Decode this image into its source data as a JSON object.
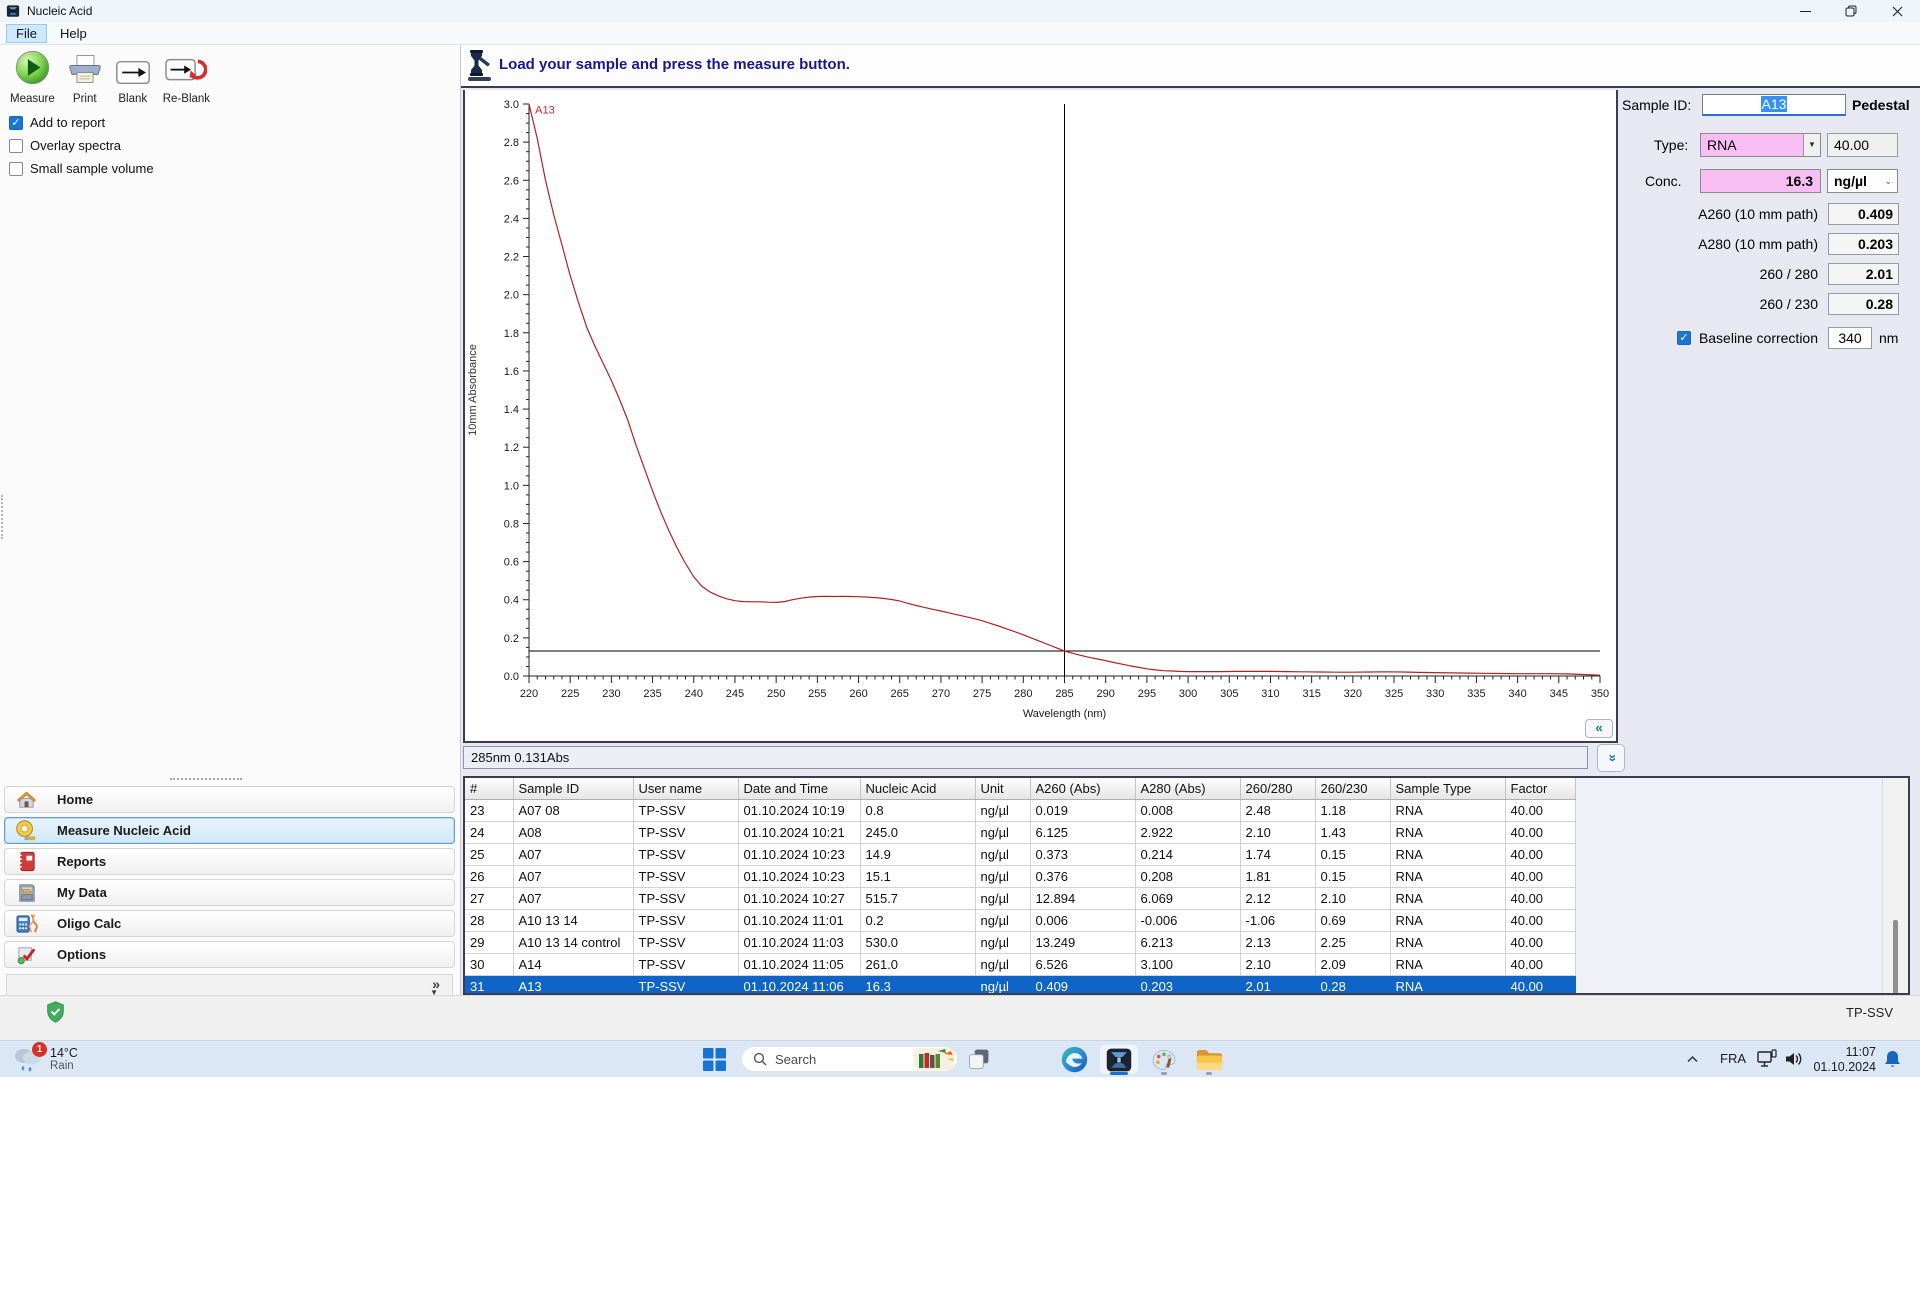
{
  "window": {
    "title": "Nucleic Acid"
  },
  "menu": {
    "items": [
      {
        "label": "File",
        "active": true
      },
      {
        "label": "Help",
        "active": false
      }
    ]
  },
  "toolbar": {
    "buttons": [
      {
        "icon": "measure-icon",
        "label": "Measure"
      },
      {
        "icon": "print-icon",
        "label": "Print"
      },
      {
        "icon": "blank-icon",
        "label": "Blank"
      },
      {
        "icon": "reblank-icon",
        "label": "Re-Blank"
      }
    ]
  },
  "report_options": [
    {
      "label": "Add to report",
      "checked": true
    },
    {
      "label": "Overlay spectra",
      "checked": false
    },
    {
      "label": "Small sample volume",
      "checked": false
    }
  ],
  "status_message": "Load your sample and press the measure button.",
  "readout": "285nm 0.131Abs",
  "sample_panel": {
    "sample_id_label": "Sample ID:",
    "sample_id_value": "A13",
    "mode_label": "Pedestal",
    "type_label": "Type:",
    "type_value": "RNA",
    "type_factor": "40.00",
    "conc_label": "Conc.",
    "conc_value": "16.3",
    "conc_unit": "ng/µl",
    "metrics": [
      {
        "label": "A260 (10 mm path)",
        "value": "0.409"
      },
      {
        "label": "A280 (10 mm path)",
        "value": "0.203"
      },
      {
        "label": "260 / 280",
        "value": "2.01"
      },
      {
        "label": "260 / 230",
        "value": "0.28"
      }
    ],
    "baseline": {
      "label": "Baseline correction",
      "checked": true,
      "value": "340",
      "unit": "nm"
    }
  },
  "chart_data": {
    "type": "line",
    "title": "",
    "xlabel": "Wavelength (nm)",
    "ylabel": "10mm Absorbance",
    "xlim": [
      220,
      350
    ],
    "ylim": [
      0.0,
      3.0
    ],
    "x_tick_step": 5,
    "x_minor_step": 1,
    "y_tick_step": 0.2,
    "y_minor_step": 0.05,
    "grid": false,
    "legend": "none",
    "annotation": {
      "text": "A13",
      "x": 220.5,
      "y": 2.97,
      "color": "#cc2222"
    },
    "crosshair": {
      "wavelength_nm": 285,
      "absorbance": 0.131
    },
    "series": [
      {
        "name": "A13",
        "color": "#b22222",
        "points": [
          [
            220,
            3.0
          ],
          [
            221,
            2.82
          ],
          [
            222,
            2.6
          ],
          [
            223,
            2.42
          ],
          [
            224,
            2.26
          ],
          [
            225,
            2.1
          ],
          [
            226,
            1.96
          ],
          [
            227,
            1.83
          ],
          [
            228,
            1.73
          ],
          [
            229,
            1.64
          ],
          [
            230,
            1.55
          ],
          [
            231,
            1.45
          ],
          [
            232,
            1.34
          ],
          [
            233,
            1.21
          ],
          [
            234,
            1.09
          ],
          [
            235,
            0.97
          ],
          [
            236,
            0.86
          ],
          [
            237,
            0.76
          ],
          [
            238,
            0.67
          ],
          [
            239,
            0.59
          ],
          [
            240,
            0.52
          ],
          [
            241,
            0.47
          ],
          [
            242,
            0.44
          ],
          [
            243,
            0.42
          ],
          [
            244,
            0.405
          ],
          [
            245,
            0.395
          ],
          [
            246,
            0.39
          ],
          [
            247,
            0.389
          ],
          [
            248,
            0.389
          ],
          [
            249,
            0.387
          ],
          [
            250,
            0.386
          ],
          [
            251,
            0.39
          ],
          [
            252,
            0.4
          ],
          [
            253,
            0.408
          ],
          [
            254,
            0.414
          ],
          [
            255,
            0.417
          ],
          [
            256,
            0.418
          ],
          [
            257,
            0.417
          ],
          [
            258,
            0.418
          ],
          [
            259,
            0.417
          ],
          [
            260,
            0.416
          ],
          [
            261,
            0.414
          ],
          [
            262,
            0.411
          ],
          [
            263,
            0.407
          ],
          [
            264,
            0.401
          ],
          [
            265,
            0.394
          ],
          [
            266,
            0.381
          ],
          [
            267,
            0.37
          ],
          [
            268,
            0.36
          ],
          [
            269,
            0.35
          ],
          [
            270,
            0.341
          ],
          [
            271,
            0.331
          ],
          [
            272,
            0.321
          ],
          [
            273,
            0.311
          ],
          [
            274,
            0.301
          ],
          [
            275,
            0.29
          ],
          [
            276,
            0.276
          ],
          [
            277,
            0.262
          ],
          [
            278,
            0.247
          ],
          [
            279,
            0.232
          ],
          [
            280,
            0.216
          ],
          [
            281,
            0.199
          ],
          [
            282,
            0.182
          ],
          [
            283,
            0.165
          ],
          [
            284,
            0.148
          ],
          [
            285,
            0.131
          ],
          [
            286,
            0.119
          ],
          [
            287,
            0.108
          ],
          [
            288,
            0.098
          ],
          [
            289,
            0.089
          ],
          [
            290,
            0.08
          ],
          [
            291,
            0.071
          ],
          [
            292,
            0.062
          ],
          [
            293,
            0.053
          ],
          [
            294,
            0.045
          ],
          [
            295,
            0.038
          ],
          [
            296,
            0.032
          ],
          [
            297,
            0.028
          ],
          [
            298,
            0.026
          ],
          [
            299,
            0.024
          ],
          [
            300,
            0.023
          ],
          [
            302,
            0.023
          ],
          [
            304,
            0.023
          ],
          [
            306,
            0.024
          ],
          [
            308,
            0.024
          ],
          [
            310,
            0.024
          ],
          [
            312,
            0.023
          ],
          [
            314,
            0.022
          ],
          [
            316,
            0.021
          ],
          [
            318,
            0.02
          ],
          [
            320,
            0.02
          ],
          [
            322,
            0.021
          ],
          [
            324,
            0.022
          ],
          [
            326,
            0.021
          ],
          [
            328,
            0.019
          ],
          [
            330,
            0.018
          ],
          [
            332,
            0.016
          ],
          [
            334,
            0.015
          ],
          [
            336,
            0.014
          ],
          [
            338,
            0.013
          ],
          [
            340,
            0.012
          ],
          [
            342,
            0.012
          ],
          [
            344,
            0.012
          ],
          [
            346,
            0.011
          ],
          [
            348,
            0.008
          ],
          [
            350,
            0.004
          ]
        ]
      }
    ]
  },
  "sidebar": {
    "items": [
      {
        "icon": "home-icon",
        "label": "Home",
        "selected": false
      },
      {
        "icon": "measure-nucleic-acid-icon",
        "label": "Measure Nucleic Acid",
        "selected": true
      },
      {
        "icon": "reports-icon",
        "label": "Reports",
        "selected": false
      },
      {
        "icon": "my-data-icon",
        "label": "My Data",
        "selected": false
      },
      {
        "icon": "oligo-calc-icon",
        "label": "Oligo Calc",
        "selected": false
      },
      {
        "icon": "options-icon",
        "label": "Options",
        "selected": false
      }
    ],
    "overflow_glyph": "»"
  },
  "table": {
    "columns": [
      "#",
      "Sample ID",
      "User name",
      "Date and Time",
      "Nucleic Acid",
      "Unit",
      "A260 (Abs)",
      "A280 (Abs)",
      "260/280",
      "260/230",
      "Sample Type",
      "Factor"
    ],
    "rows": [
      [
        "23",
        "A07 08",
        "TP-SSV",
        "01.10.2024 10:19",
        "0.8",
        "ng/µl",
        "0.019",
        "0.008",
        "2.48",
        "1.18",
        "RNA",
        "40.00"
      ],
      [
        "24",
        "A08",
        "TP-SSV",
        "01.10.2024 10:21",
        "245.0",
        "ng/µl",
        "6.125",
        "2.922",
        "2.10",
        "1.43",
        "RNA",
        "40.00"
      ],
      [
        "25",
        "A07",
        "TP-SSV",
        "01.10.2024 10:23",
        "14.9",
        "ng/µl",
        "0.373",
        "0.214",
        "1.74",
        "0.15",
        "RNA",
        "40.00"
      ],
      [
        "26",
        "A07",
        "TP-SSV",
        "01.10.2024 10:23",
        "15.1",
        "ng/µl",
        "0.376",
        "0.208",
        "1.81",
        "0.15",
        "RNA",
        "40.00"
      ],
      [
        "27",
        "A07",
        "TP-SSV",
        "01.10.2024 10:27",
        "515.7",
        "ng/µl",
        "12.894",
        "6.069",
        "2.12",
        "2.10",
        "RNA",
        "40.00"
      ],
      [
        "28",
        "A10 13 14",
        "TP-SSV",
        "01.10.2024 11:01",
        "0.2",
        "ng/µl",
        "0.006",
        "-0.006",
        "-1.06",
        "0.69",
        "RNA",
        "40.00"
      ],
      [
        "29",
        "A10 13 14 control",
        "TP-SSV",
        "01.10.2024 11:03",
        "530.0",
        "ng/µl",
        "13.249",
        "6.213",
        "2.13",
        "2.25",
        "RNA",
        "40.00"
      ],
      [
        "30",
        "A14",
        "TP-SSV",
        "01.10.2024 11:05",
        "261.0",
        "ng/µl",
        "6.526",
        "3.100",
        "2.10",
        "2.09",
        "RNA",
        "40.00"
      ],
      [
        "31",
        "A13",
        "TP-SSV",
        "01.10.2024 11:06",
        "16.3",
        "ng/µl",
        "0.409",
        "0.203",
        "2.01",
        "0.28",
        "RNA",
        "40.00"
      ]
    ],
    "selected_row": 8
  },
  "app_statusbar": {
    "user": "TP-SSV"
  },
  "taskbar": {
    "weather": {
      "badge": "1",
      "temp": "14°C",
      "condition": "Rain"
    },
    "search": {
      "placeholder": "Search"
    },
    "apps": [
      {
        "icon": "edge-icon",
        "active": false,
        "running": false
      },
      {
        "icon": "nanodrop-app-icon",
        "active": true,
        "running": true
      },
      {
        "icon": "paint-icon",
        "active": false,
        "running": true
      },
      {
        "icon": "file-explorer-icon",
        "active": false,
        "running": true
      }
    ],
    "tray": {
      "language": "FRA",
      "time": "11:07",
      "date": "01.10.2024"
    }
  }
}
